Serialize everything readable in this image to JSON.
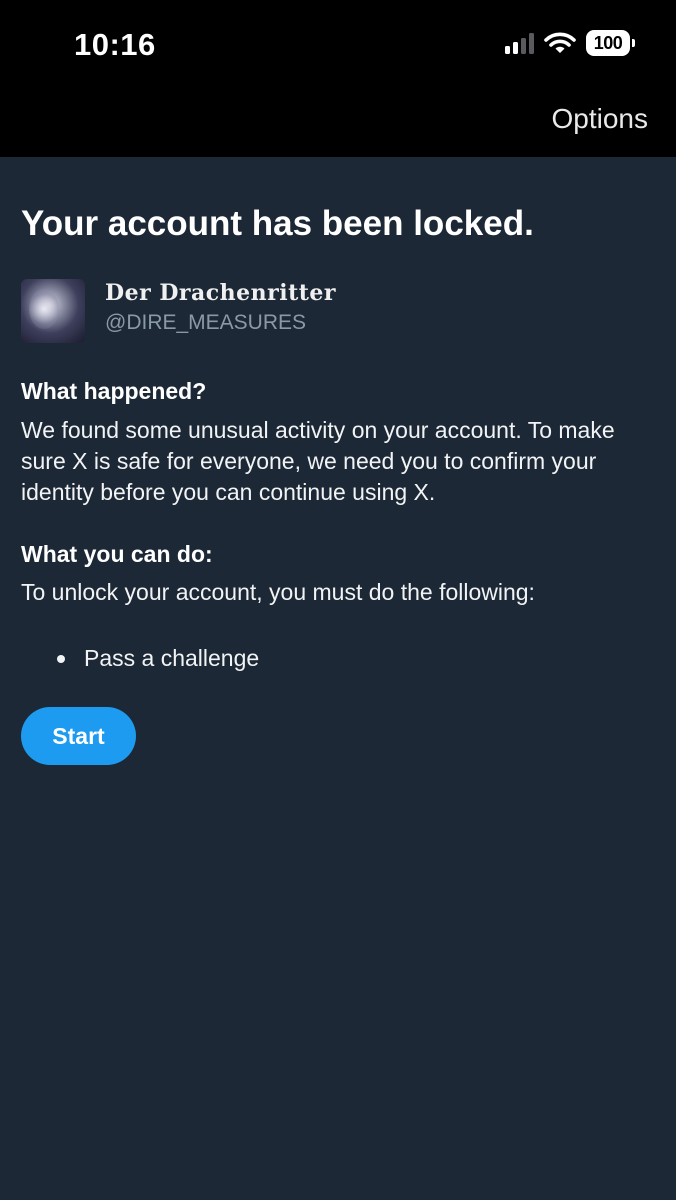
{
  "status_bar": {
    "time": "10:16",
    "battery": "100",
    "icons": [
      "signal-icon",
      "wifi-icon",
      "battery-icon"
    ]
  },
  "header": {
    "options_label": "Options"
  },
  "page": {
    "title": "Your account has been locked."
  },
  "account": {
    "display_name": "Der Drachenritter",
    "handle": "@DIRE_MEASURES"
  },
  "what_happened": {
    "title": "What happened?",
    "body": "We found some unusual activity on your account. To make sure X is safe for everyone, we need you to confirm your identity before you can continue using X."
  },
  "what_you_can_do": {
    "title": "What you can do:",
    "body": "To unlock your account, you must do the following:",
    "items": [
      "Pass a challenge"
    ]
  },
  "actions": {
    "start_label": "Start"
  },
  "colors": {
    "background": "#1c2836",
    "header_background": "#000000",
    "accent": "#1d9bf0",
    "secondary_text": "#8b98a5"
  }
}
